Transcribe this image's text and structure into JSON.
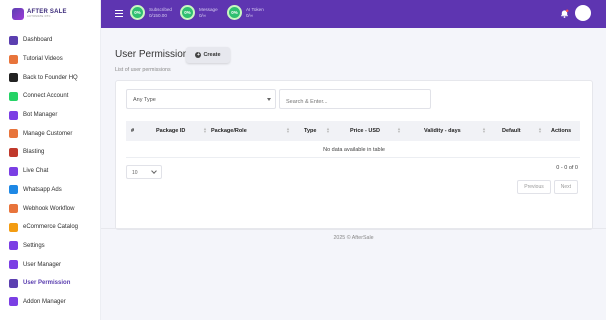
{
  "brand": {
    "name": "AFTER SALE",
    "tagline": "AUTOMATE DTC"
  },
  "sidebar": {
    "items": [
      {
        "label": "Dashboard",
        "icon": "dashboard-icon",
        "color": "#5b3fb0"
      },
      {
        "label": "Tutorial Videos",
        "icon": "video-icon",
        "color": "#e8743b"
      },
      {
        "label": "Back to Founder HQ",
        "icon": "founder-hq-icon",
        "color": "#222222"
      },
      {
        "label": "Connect Account",
        "icon": "whatsapp-icon",
        "color": "#25d366"
      },
      {
        "label": "Bot Manager",
        "icon": "bot-icon",
        "color": "#7b3fe4"
      },
      {
        "label": "Manage Customer",
        "icon": "customers-icon",
        "color": "#e8743b"
      },
      {
        "label": "Blasting",
        "icon": "megaphone-icon",
        "color": "#c0392b"
      },
      {
        "label": "Live Chat",
        "icon": "chat-icon",
        "color": "#7b3fe4"
      },
      {
        "label": "Whatsapp Ads",
        "icon": "ads-icon",
        "color": "#1e88e5"
      },
      {
        "label": "Webhook Workflow",
        "icon": "webhook-icon",
        "color": "#e8743b"
      },
      {
        "label": "eCommerce Catalog",
        "icon": "catalog-icon",
        "color": "#f39c12"
      },
      {
        "label": "Settings",
        "icon": "gear-icon",
        "color": "#7b3fe4"
      },
      {
        "label": "User Manager",
        "icon": "user-icon",
        "color": "#7b3fe4"
      },
      {
        "label": "User Permission",
        "icon": "shield-icon",
        "color": "#5b3fb0",
        "active": true
      },
      {
        "label": "Addon Manager",
        "icon": "addon-icon",
        "color": "#7b3fe4"
      }
    ]
  },
  "topbar": {
    "stats": [
      {
        "percent": "0%",
        "label": "Subscribed",
        "value": "0/150.00"
      },
      {
        "percent": "0%",
        "label": "Message",
        "value": "0/∞"
      },
      {
        "percent": "0%",
        "label": "AI Token",
        "value": "0/∞"
      }
    ],
    "accent": "#5e35b1"
  },
  "page": {
    "title": "User Permission",
    "create_label": "Create",
    "subtitle": "List of user permissions",
    "filter_value": "Any Type",
    "search_placeholder": "Search & Enter...",
    "columns": [
      "#",
      "Package ID",
      "Package/Role",
      "Type",
      "Price - USD",
      "Validity - days",
      "Default",
      "Actions"
    ],
    "empty_message": "No data available in table",
    "page_size": "10",
    "page_info": "0 - 0 of 0",
    "prev_label": "Previous",
    "next_label": "Next"
  },
  "footer": {
    "text": "2025 © AfterSale"
  }
}
